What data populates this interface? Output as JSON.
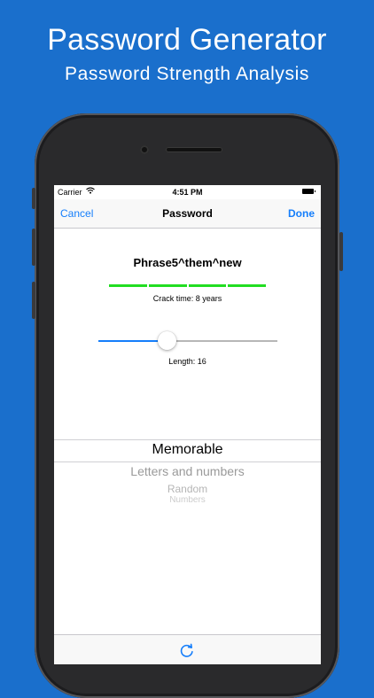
{
  "promo": {
    "title": "Password Generator",
    "subtitle": "Password Strength Analysis"
  },
  "status_bar": {
    "carrier": "Carrier",
    "time": "4:51 PM"
  },
  "nav": {
    "cancel_label": "Cancel",
    "title": "Password",
    "done_label": "Done"
  },
  "generator": {
    "password": "Phrase5^them^new",
    "strength_segments": 4,
    "crack_time_text": "Crack time: 8 years",
    "length_value": 0.38,
    "length_text": "Length: 16"
  },
  "picker": {
    "selected": "Memorable",
    "options": [
      "Letters and numbers",
      "Random",
      "Numbers"
    ]
  },
  "colors": {
    "background": "#1a6fcc",
    "accent": "#157efb",
    "strength": "#22dd22"
  },
  "icons": {
    "wifi": "wifi-icon",
    "battery": "battery-icon",
    "refresh": "refresh-icon"
  }
}
